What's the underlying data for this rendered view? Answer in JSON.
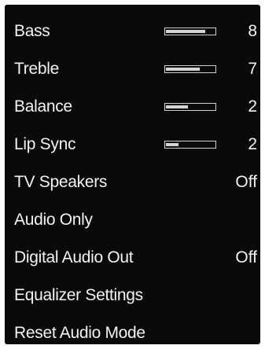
{
  "menu": {
    "items": [
      {
        "label": "Bass",
        "value": "8",
        "level": 0.8
      },
      {
        "label": "Treble",
        "value": "7",
        "level": 0.7
      },
      {
        "label": "Balance",
        "value": "2",
        "level": 0.45
      },
      {
        "label": "Lip Sync",
        "value": "2",
        "level": 0.25
      },
      {
        "label": "TV Speakers",
        "value": "Off"
      },
      {
        "label": "Audio Only"
      },
      {
        "label": "Digital Audio Out",
        "value": "Off"
      },
      {
        "label": "Equalizer Settings"
      },
      {
        "label": "Reset Audio Mode"
      }
    ]
  },
  "colors": {
    "background": "#0a0a0a",
    "text": "#f2f2f2",
    "slider_fill": "#d4d4d4",
    "slider_border": "#cfcfcf"
  }
}
